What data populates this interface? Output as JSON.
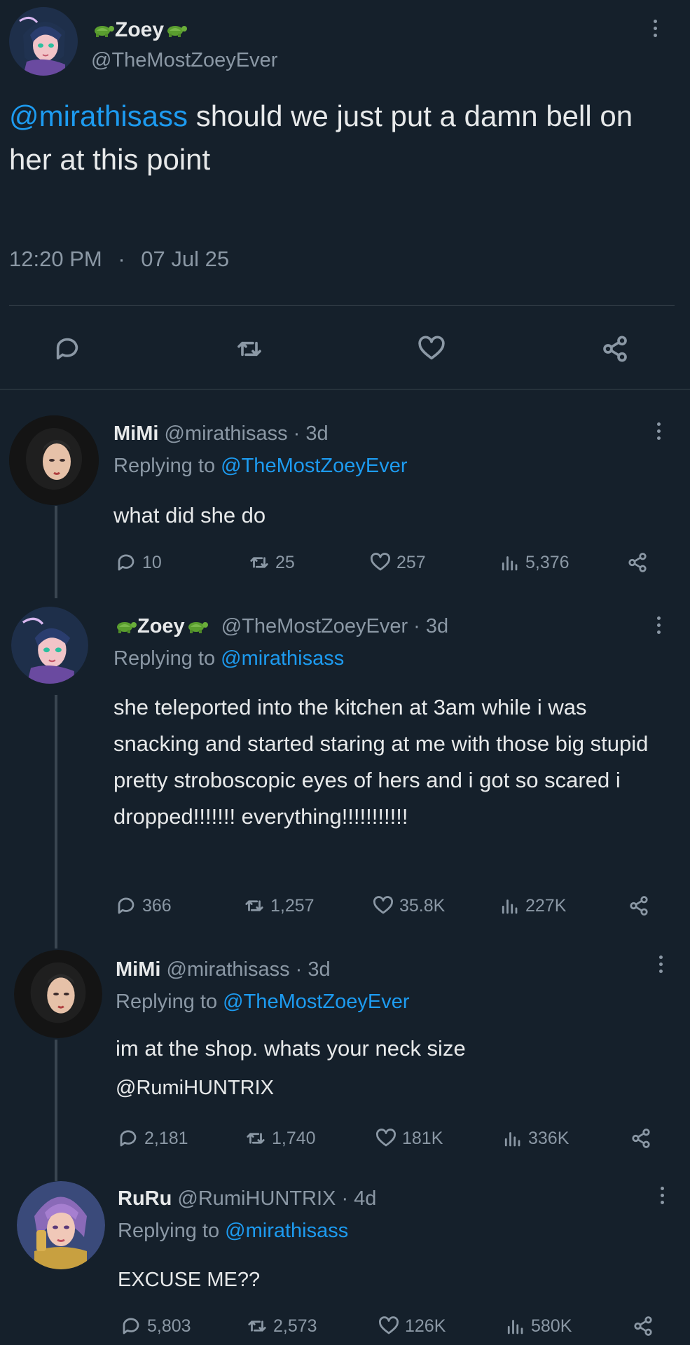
{
  "main_tweet": {
    "display_name": "Zoey",
    "handle": "@TheMostZoeyEver",
    "mention": "@mirathisass",
    "text": "should we just put a damn bell on her at this point",
    "time": "12:20 PM",
    "separator": "·",
    "date": "07 Jul 25"
  },
  "replies": [
    {
      "name": "MiMi",
      "handle": "@mirathisass",
      "age": "· 3d",
      "replying_prefix": "Replying to",
      "replying_to": "@TheMostZoeyEver",
      "text": "what did she do",
      "mention": "",
      "stats": {
        "replies": "10",
        "retweets": "25",
        "likes": "257",
        "views": "5,376"
      }
    },
    {
      "name": "Zoey",
      "handle": "@TheMostZoeyEver",
      "age": "· 3d",
      "replying_prefix": "Replying to",
      "replying_to": "@mirathisass",
      "text": "she teleported into the kitchen at 3am while i was snacking and started staring at me with those big stupid pretty stroboscopic eyes of hers and i got so scared i dropped!!!!!!! everything!!!!!!!!!!!",
      "mention": "",
      "stats": {
        "replies": "366",
        "retweets": "1,257",
        "likes": "35.8K",
        "views": "227K"
      }
    },
    {
      "name": "MiMi",
      "handle": "@mirathisass",
      "age": "· 3d",
      "replying_prefix": "Replying to",
      "replying_to": "@TheMostZoeyEver",
      "text": "im at the shop. whats your neck size",
      "mention": "@RumiHUNTRIX",
      "stats": {
        "replies": "2,181",
        "retweets": "1,740",
        "likes": "181K",
        "views": "336K"
      }
    },
    {
      "name": "RuRu",
      "handle": "@RumiHUNTRIX",
      "age": "· 4d",
      "replying_prefix": "Replying to",
      "replying_to": "@mirathisass",
      "text": "EXCUSE ME??",
      "mention": "",
      "stats": {
        "replies": "5,803",
        "retweets": "2,573",
        "likes": "126K",
        "views": "580K"
      }
    }
  ],
  "icons": [
    "more-vertical-icon",
    "reply-icon",
    "retweet-icon",
    "like-icon",
    "views-icon",
    "share-icon",
    "turtle-emoji"
  ],
  "colors": {
    "background": "#15202b",
    "text": "#e7e9ea",
    "muted": "#8b98a5",
    "link": "#1d9bf0",
    "divider": "#38444d"
  }
}
